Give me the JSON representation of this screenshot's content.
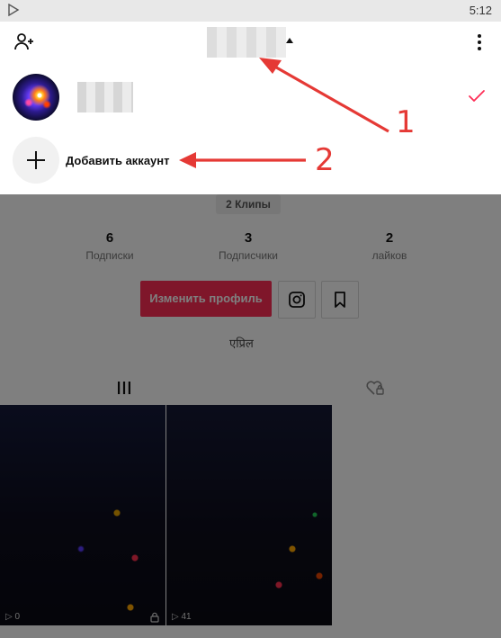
{
  "status_bar": {
    "time": "5:12"
  },
  "profile": {
    "clips_pill": "2 Клипы",
    "stats": [
      {
        "value": "6",
        "label": "Подписки"
      },
      {
        "value": "3",
        "label": "Подписчики"
      },
      {
        "value": "2",
        "label": "лайков"
      }
    ],
    "edit_profile_label": "Изменить профиль",
    "bio": "एप्रिल",
    "videos": [
      {
        "views": "0"
      },
      {
        "views": "41"
      }
    ]
  },
  "account_sheet": {
    "add_account_label": "Добавить аккаунт"
  },
  "annotations": [
    {
      "number": "1"
    },
    {
      "number": "2"
    }
  ],
  "colors": {
    "accent": "#fe2c55",
    "annotation": "#e53935"
  }
}
